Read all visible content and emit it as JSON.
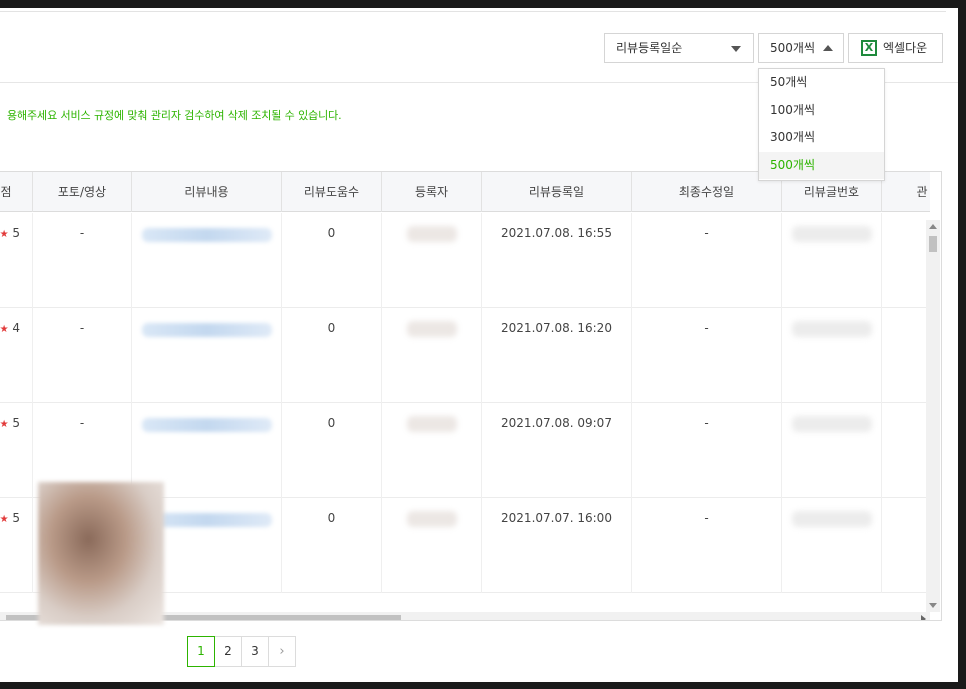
{
  "toolbar": {
    "sort_select": {
      "value": "리뷰등록일순",
      "icon": "chevron-down-icon"
    },
    "count_select": {
      "value": "500개씩",
      "icon": "chevron-up-icon"
    },
    "excel_button": {
      "label": "엑셀다운",
      "icon": "excel-icon",
      "icon_glyph": "X"
    }
  },
  "count_dropdown": {
    "options": [
      "50개씩",
      "100개씩",
      "300개씩",
      "500개씩"
    ],
    "selected": "500개씩"
  },
  "notice": {
    "text": "용해주세요 서비스 규정에 맞춰 관리자 검수하여 삭제 조치될 수 있습니다."
  },
  "table": {
    "headers": [
      "점",
      "포토/영상",
      "리뷰내용",
      "리뷰도움수",
      "등록자",
      "리뷰등록일",
      "최종수정일",
      "리뷰글번호",
      "관"
    ],
    "rows": [
      {
        "rating": "5",
        "photo": "-",
        "helpful": "0",
        "registered": "2021.07.08. 16:55",
        "modified": "-"
      },
      {
        "rating": "4",
        "photo": "-",
        "helpful": "0",
        "registered": "2021.07.08. 16:20",
        "modified": "-"
      },
      {
        "rating": "5",
        "photo": "-",
        "helpful": "0",
        "registered": "2021.07.08. 09:07",
        "modified": "-"
      },
      {
        "rating": "5",
        "photo": "",
        "helpful": "0",
        "registered": "2021.07.07. 16:00",
        "modified": "-"
      }
    ]
  },
  "pagination": {
    "pages": [
      "1",
      "2",
      "3"
    ],
    "current": "1",
    "next_icon": "chevron-right-icon",
    "next_glyph": "›"
  },
  "colors": {
    "accent": "#2db400",
    "star": "#e23b3b"
  }
}
